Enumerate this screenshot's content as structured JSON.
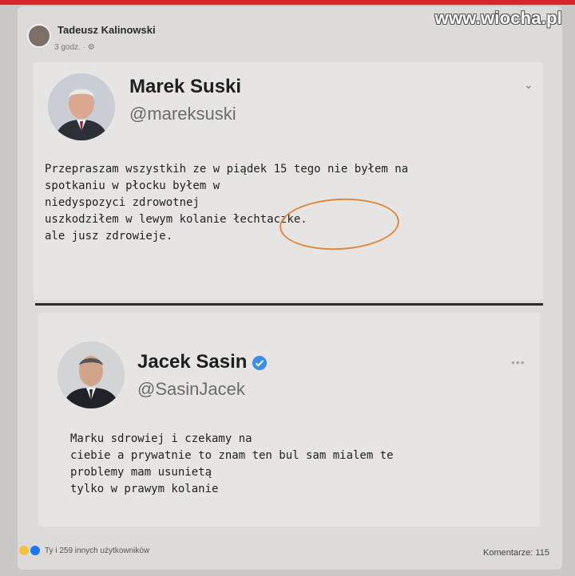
{
  "watermark": "www.wiocha.pl",
  "facebook": {
    "poster_name": "Tadeusz Kalinowski",
    "time": "3 godz. · ⚙",
    "reactions_text": "Ty i 259 innych użytkowników",
    "comments_text": "Komentarze: 115"
  },
  "tweet1": {
    "name": "Marek Suski",
    "handle": "@mareksuski",
    "text": "Przepraszam wszystkih ze w piądek 15 tego nie byłem na\nspotkaniu w płocku byłem w\nniedyspozyci zdrowotnej\nuszkodziłem w lewym kolanie łechtaczke.\nale jusz zdrowieje."
  },
  "tweet2": {
    "name": "Jacek Sasin",
    "handle": "@SasinJacek",
    "text": "Marku sdrowiej i czekamy na\nciebie a prywatnie to znam ten bul sam mialem te\nproblemy mam usunietą\ntylko w prawym kolanie"
  },
  "colors": {
    "accent_red": "#d8262b",
    "verified_blue": "#3b8ee8",
    "annotation_orange": "#e0893e"
  },
  "icons": {
    "options": "chevron-down-icon",
    "more": "more-dots-icon",
    "verified": "verified-badge-icon"
  }
}
